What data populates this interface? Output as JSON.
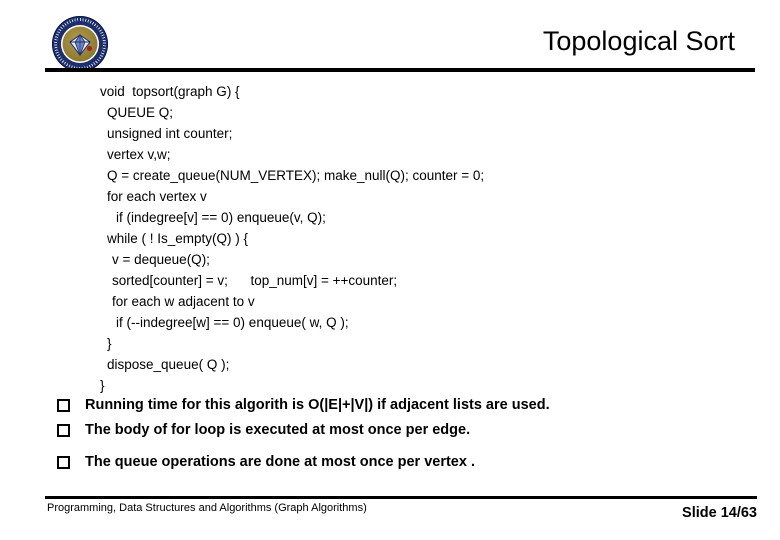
{
  "slide": {
    "title": "Topological Sort",
    "logo_alt": "university-seal"
  },
  "code": {
    "lines": [
      {
        "indent": 0,
        "text": "void  topsort(graph G) {"
      },
      {
        "indent": 1,
        "text": "QUEUE Q;"
      },
      {
        "indent": 1,
        "text": "unsigned int counter;"
      },
      {
        "indent": 1,
        "text": "vertex v,w;"
      },
      {
        "indent": 1,
        "text": "Q = create_queue(NUM_VERTEX); make_null(Q); counter = 0;"
      },
      {
        "indent": 1,
        "text": "for each vertex v"
      },
      {
        "indent": 3,
        "text": "if (indegree[v] == 0) enqueue(v, Q);"
      },
      {
        "indent": 1,
        "text": "while ( ! Is_empty(Q) ) {"
      },
      {
        "indent": 2,
        "text": "v = dequeue(Q);"
      },
      {
        "indent": 2,
        "text": "sorted[counter] = v;      top_num[v] = ++counter;"
      },
      {
        "indent": 2,
        "text": "for each w adjacent to v"
      },
      {
        "indent": 3,
        "text": "if (--indegree[w] == 0) enqueue( w, Q );"
      },
      {
        "indent": 1,
        "text": "}"
      },
      {
        "indent": 1,
        "text": "dispose_queue( Q );"
      },
      {
        "indent": 0,
        "text": "}"
      }
    ]
  },
  "bullets": [
    {
      "marker": "q",
      "text": "Running time for this algorith is O(|E|+|V|) if adjacent lists are used."
    },
    {
      "marker": "q",
      "text": "The body of for loop is executed at most once per edge."
    },
    {
      "marker": "q",
      "text": "The queue operations are done at most once per vertex ."
    }
  ],
  "footer": {
    "left": "Programming, Data Structures and Algorithms  (Graph Algorithms)",
    "right": "Slide 14/63"
  },
  "colors": {
    "rule": "#000000",
    "text": "#000000",
    "seal_ring": "#1d2f6b",
    "seal_inner": "#8e7a32",
    "seal_accent": "#a8201f"
  }
}
